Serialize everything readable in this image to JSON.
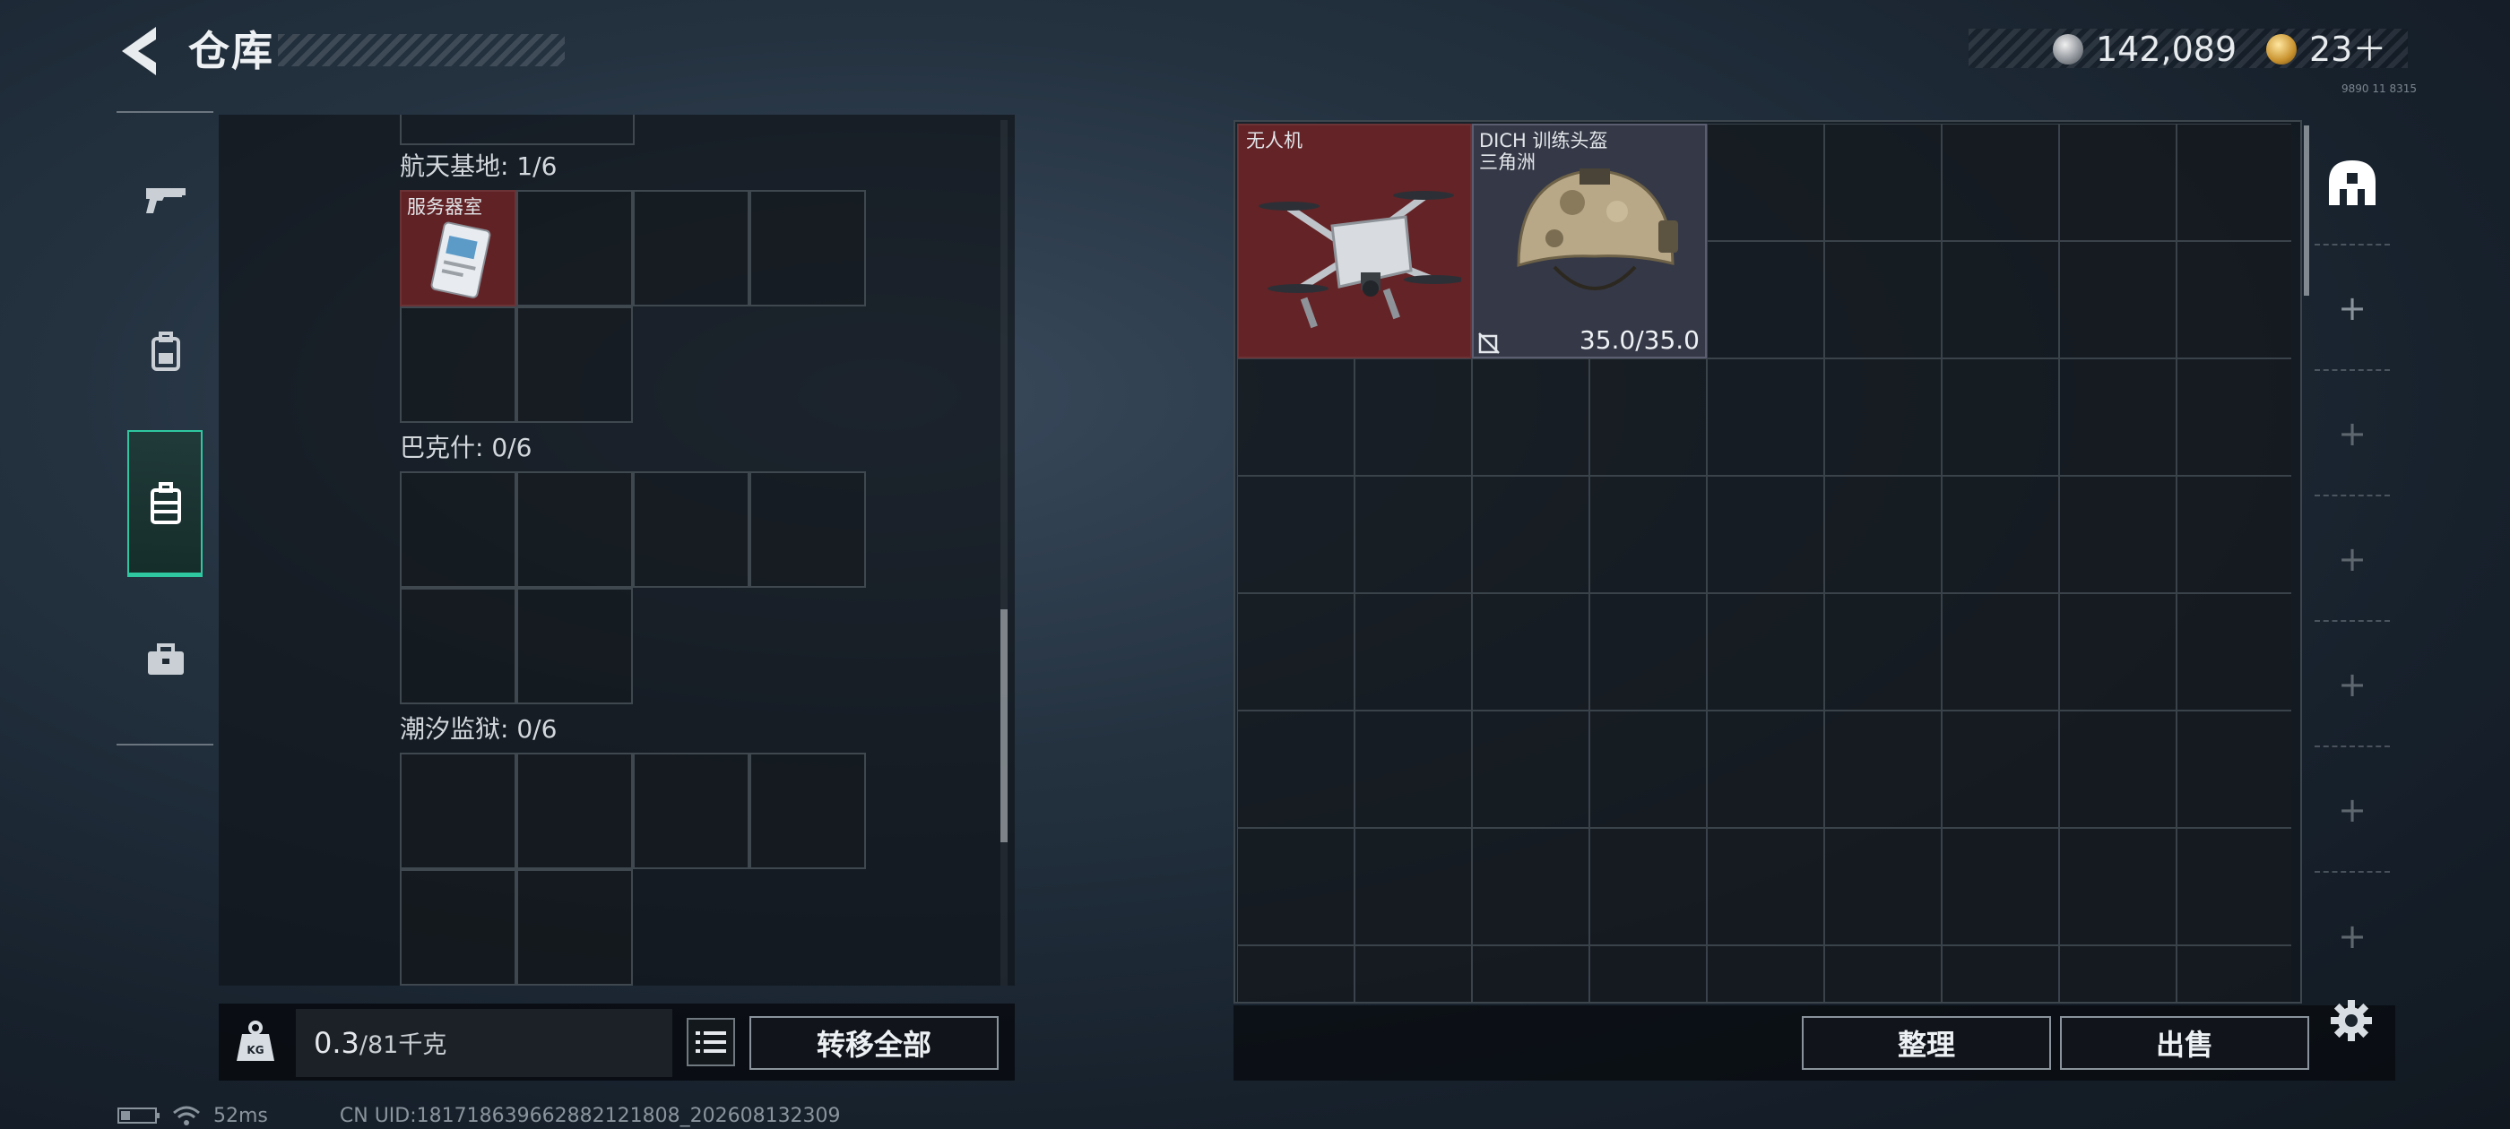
{
  "header": {
    "title": "仓库",
    "currencies": [
      {
        "name": "silver-coin",
        "value": "142,089"
      },
      {
        "name": "gold-coin",
        "value": "23＋"
      }
    ],
    "tiny_text": "9890 11 8315"
  },
  "nav": {
    "items": [
      {
        "icon": "pistol-icon",
        "active": false
      },
      {
        "icon": "backpack-icon",
        "active": false
      },
      {
        "icon": "storage-case-icon",
        "active": true
      },
      {
        "icon": "toolbox-icon",
        "active": false
      }
    ]
  },
  "left": {
    "sections": [
      {
        "label": "航天基地: 1/6",
        "items": [
          {
            "name": "服务器室",
            "icon": "keycard-icon"
          }
        ]
      },
      {
        "label": "巴克什: 0/6",
        "items": []
      },
      {
        "label": "潮汐监狱: 0/6",
        "items": []
      }
    ],
    "weight": {
      "current": "0.3",
      "capacity": "/81千克",
      "icon": "kg-icon"
    },
    "list_icon": "list-icon",
    "transfer_all": "转移全部"
  },
  "right": {
    "items": [
      {
        "name": "无人机",
        "icon": "drone-icon"
      },
      {
        "name": "DICH 训练头盔",
        "subtitle": "三角洲",
        "icon": "helmet-icon",
        "durability": "35.0/35.0",
        "status_icon": "no-repair-icon"
      }
    ],
    "sort": "整理",
    "sell": "出售",
    "side_tabs": [
      "warehouse-icon",
      "plus-icon",
      "plus-icon",
      "plus-icon",
      "plus-icon",
      "plus-icon",
      "plus-icon"
    ],
    "settings_icon": "gear-icon"
  },
  "status": {
    "ping": "52ms",
    "uid": "CN UID:18171863966288212180​8_202608132309"
  },
  "colors": {
    "accent": "#2ec7a0",
    "red_item": "#6e2326",
    "helmet_item": "#373a48"
  }
}
